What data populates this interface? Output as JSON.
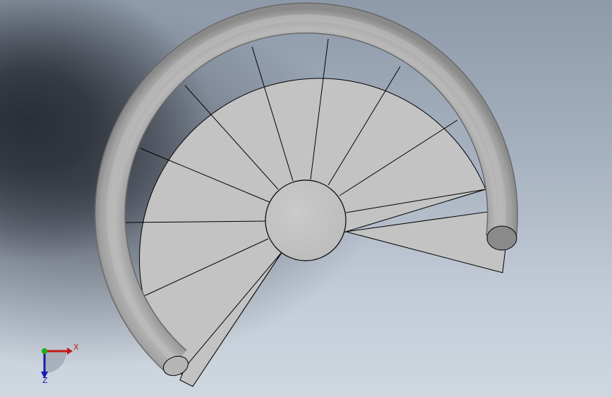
{
  "viewport": {
    "background_dark": "#2a2e36",
    "background_light": "#cfd7e0"
  },
  "model": {
    "step_count": 13,
    "step_fill": "#c3c3c3",
    "step_edge": "#000000",
    "rail_color": "#a6a6a6",
    "pole_fill": "#c4c4c4"
  },
  "triad": {
    "x_label": "X",
    "z_label": "Z",
    "x_color": "#c01818",
    "y_color": "#18b018",
    "z_color": "#1a1ab0"
  }
}
